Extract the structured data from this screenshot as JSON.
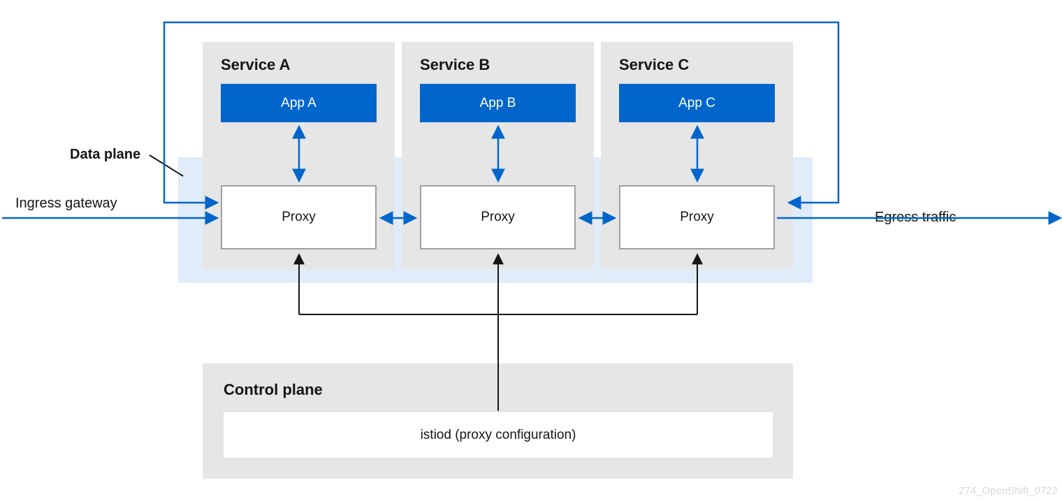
{
  "labels": {
    "ingress": "Ingress gateway",
    "egress": "Egress traffic",
    "data_plane": "Data plane",
    "control_plane": "Control plane",
    "istiod": "istiod (proxy configuration)",
    "proxy": "Proxy",
    "watermark": "274_OpenShift_0722"
  },
  "services": [
    {
      "title": "Service A",
      "app": "App A"
    },
    {
      "title": "Service B",
      "app": "App B"
    },
    {
      "title": "Service C",
      "app": "App C"
    }
  ],
  "colors": {
    "blue": "#0066cc",
    "light_blue_overlay": "rgba(0,102,204,0.12)",
    "panel_grey": "#e6e6e6",
    "border_grey": "#a0a0a0",
    "black": "#151515"
  }
}
